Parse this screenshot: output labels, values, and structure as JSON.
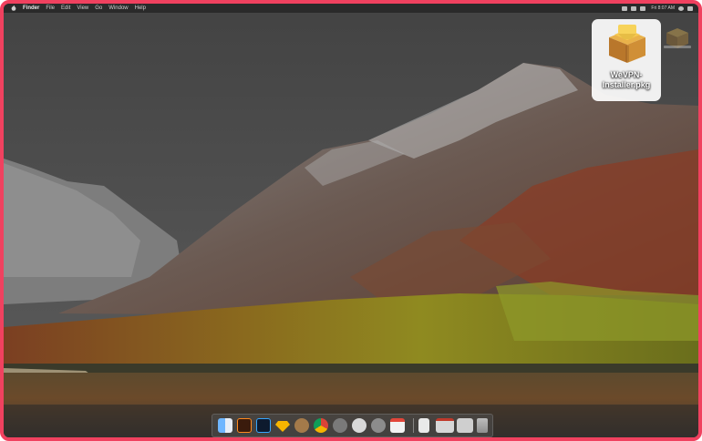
{
  "menubar": {
    "apple_icon": "apple-icon",
    "items": [
      "Finder",
      "File",
      "Edit",
      "View",
      "Go",
      "Window",
      "Help"
    ],
    "clock": "Fri 8:07 AM"
  },
  "desktop": {
    "wallpaper": "mountain-lake-autumn",
    "selected_file": {
      "name_line1": "WeVPN-",
      "name_line2": "Installer.pkg",
      "icon": "package-installer-icon"
    },
    "secondary_file_icon": "package-icon"
  },
  "dock": {
    "apps": [
      "finder-icon",
      "illustrator-icon",
      "photoshop-icon",
      "sketch-icon",
      "tweetbot-icon",
      "chrome-icon",
      "launchpad-icon",
      "itunes-icon",
      "app-store-icon",
      "calendar-icon",
      "document-icon",
      "receipt-icon",
      "keyboard-icon",
      "trash-icon"
    ]
  },
  "colors": {
    "frame_border": "#f0415f",
    "selection_bg": "#f5f5f5"
  }
}
